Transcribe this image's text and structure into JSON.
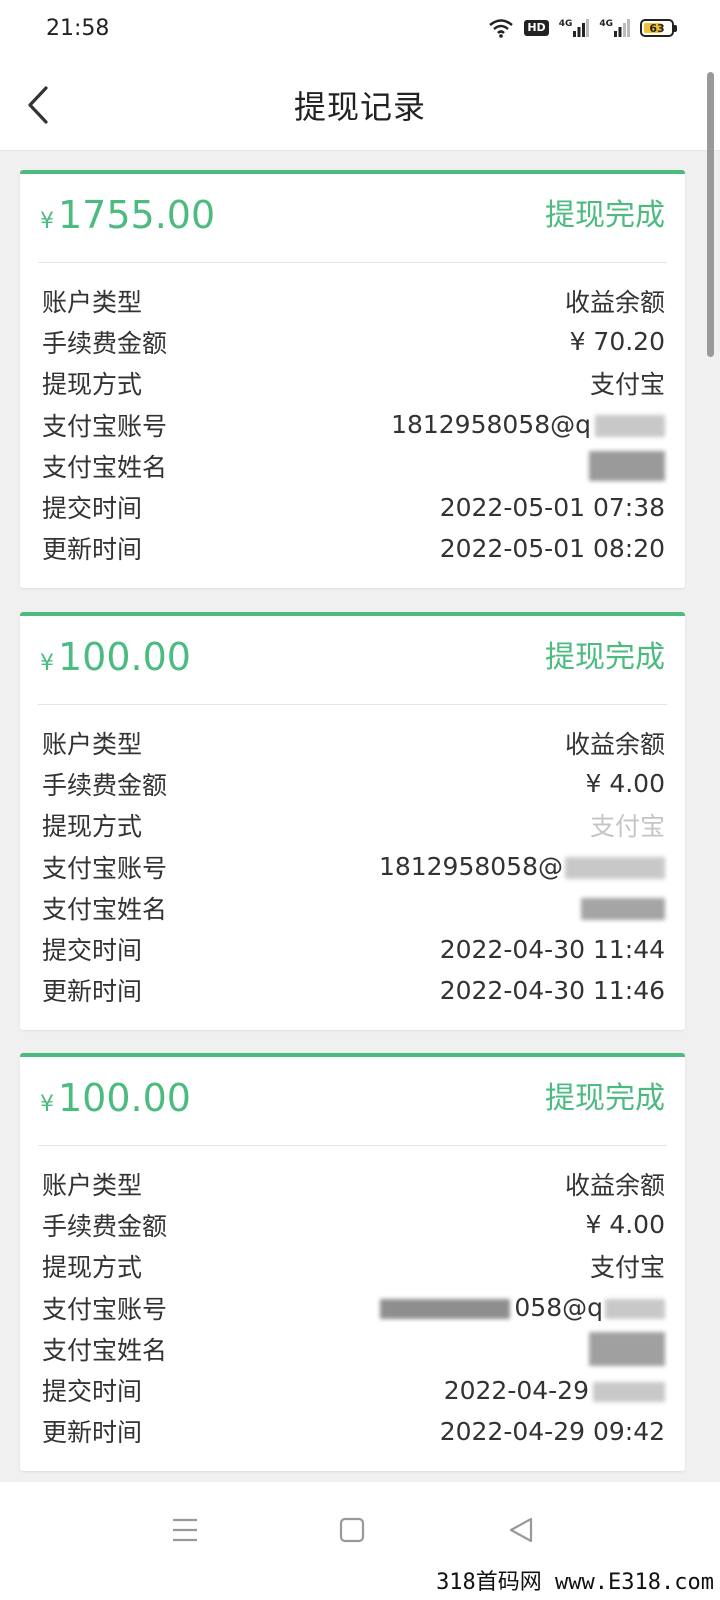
{
  "status_bar": {
    "time": "21:58",
    "hd_label": "HD",
    "network_1": "4G",
    "network_2": "4G",
    "battery": "63"
  },
  "nav": {
    "title": "提现记录",
    "back_icon": "chevron-left-icon"
  },
  "theme": {
    "accent": "#4cbb7f",
    "text": "#333333",
    "background": "#f0f0f0"
  },
  "records": [
    {
      "currency": "¥",
      "amount": "1755.00",
      "status": "提现完成",
      "account_type_label": "账户类型",
      "account_type": "收益余额",
      "fee_label": "手续费金额",
      "fee": "¥ 70.20",
      "method_label": "提现方式",
      "method": "支付宝",
      "alipay_account_label": "支付宝账号",
      "alipay_account": "1812958058@q",
      "alipay_name_label": "支付宝姓名",
      "submit_time_label": "提交时间",
      "submit_time": "2022-05-01 07:38",
      "update_time_label": "更新时间",
      "update_time": "2022-05-01 08:20"
    },
    {
      "currency": "¥",
      "amount": "100.00",
      "status": "提现完成",
      "account_type_label": "账户类型",
      "account_type": "收益余额",
      "fee_label": "手续费金额",
      "fee": "¥ 4.00",
      "method_label": "提现方式",
      "method": "支付宝",
      "alipay_account_label": "支付宝账号",
      "alipay_account": "1812958058@",
      "alipay_name_label": "支付宝姓名",
      "submit_time_label": "提交时间",
      "submit_time": "2022-04-30 11:44",
      "update_time_label": "更新时间",
      "update_time": "2022-04-30 11:46"
    },
    {
      "currency": "¥",
      "amount": "100.00",
      "status": "提现完成",
      "account_type_label": "账户类型",
      "account_type": "收益余额",
      "fee_label": "手续费金额",
      "fee": "¥ 4.00",
      "method_label": "提现方式",
      "method": "支付宝",
      "alipay_account_label": "支付宝账号",
      "alipay_account": "058@q",
      "alipay_name_label": "支付宝姓名",
      "submit_time_label": "提交时间",
      "submit_time": "2022-04-29",
      "update_time_label": "更新时间",
      "update_time": "2022-04-29 09:42"
    }
  ],
  "bottom_nav": {
    "menu_icon": "menu-icon",
    "home_icon": "home-square-icon",
    "back_icon": "back-triangle-icon"
  },
  "watermark": "318首码网 www.E318.com"
}
